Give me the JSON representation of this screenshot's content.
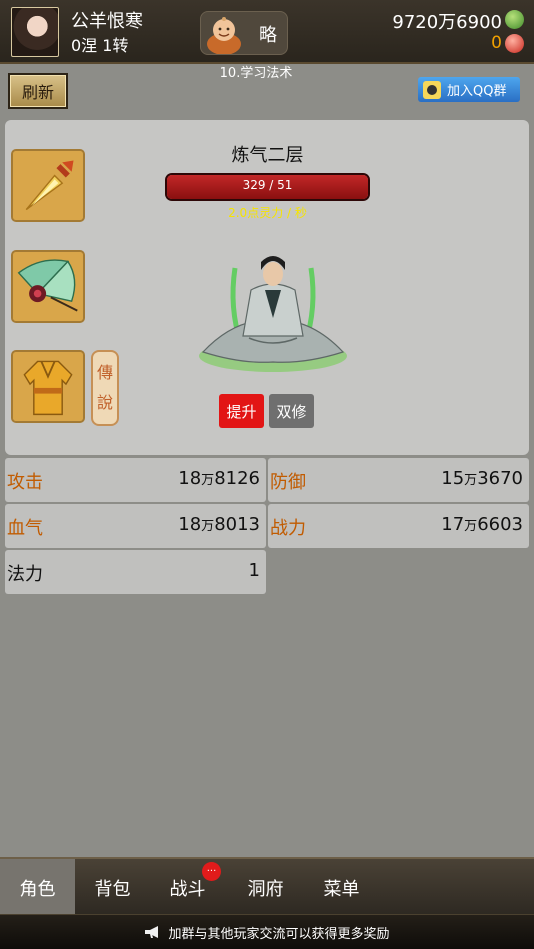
{
  "header": {
    "player_name": "公羊恨寒",
    "player_rank": "0涅 1转",
    "hint_label": "略",
    "task_label": "10.学习法术",
    "gold": "9720万6900",
    "gems": "0",
    "gold_icon": "jade-coin-icon",
    "gem_icon": "red-gem-icon"
  },
  "toolbar": {
    "refresh_label": "刷新",
    "qq_label": "加入QQ群"
  },
  "character": {
    "realm": "炼气二层",
    "exp_text": "329 / 51",
    "exp_progress": 1.0,
    "rate": "2.0点灵力 / 秒",
    "upgrade_label": "提升",
    "dual_label": "双修",
    "equipment": [
      "dagger-weapon-icon",
      "fan-treasure-icon",
      "robe-armor-icon"
    ],
    "legend_tag": "傳說"
  },
  "stats": {
    "attack": {
      "label": "攻击",
      "main": "18",
      "unit": "万",
      "rest": "8126"
    },
    "defense": {
      "label": "防御",
      "main": "15",
      "unit": "万",
      "rest": "3670"
    },
    "hp": {
      "label": "血气",
      "main": "18",
      "unit": "万",
      "rest": "8013"
    },
    "power": {
      "label": "战力",
      "main": "17",
      "unit": "万",
      "rest": "6603"
    },
    "mana": {
      "label": "法力",
      "value": "1"
    }
  },
  "tabs": [
    {
      "label": "角色",
      "active": true
    },
    {
      "label": "背包",
      "active": false
    },
    {
      "label": "战斗",
      "active": false
    },
    {
      "label": "洞府",
      "active": false
    },
    {
      "label": "菜单",
      "active": false
    }
  ],
  "battle_badge": "...",
  "notice": "加群与其他玩家交流可以获得更多奖励",
  "colors": {
    "accent_red": "#e21515",
    "stat_label": "#c15b00",
    "rate_yellow": "#f6e400"
  }
}
